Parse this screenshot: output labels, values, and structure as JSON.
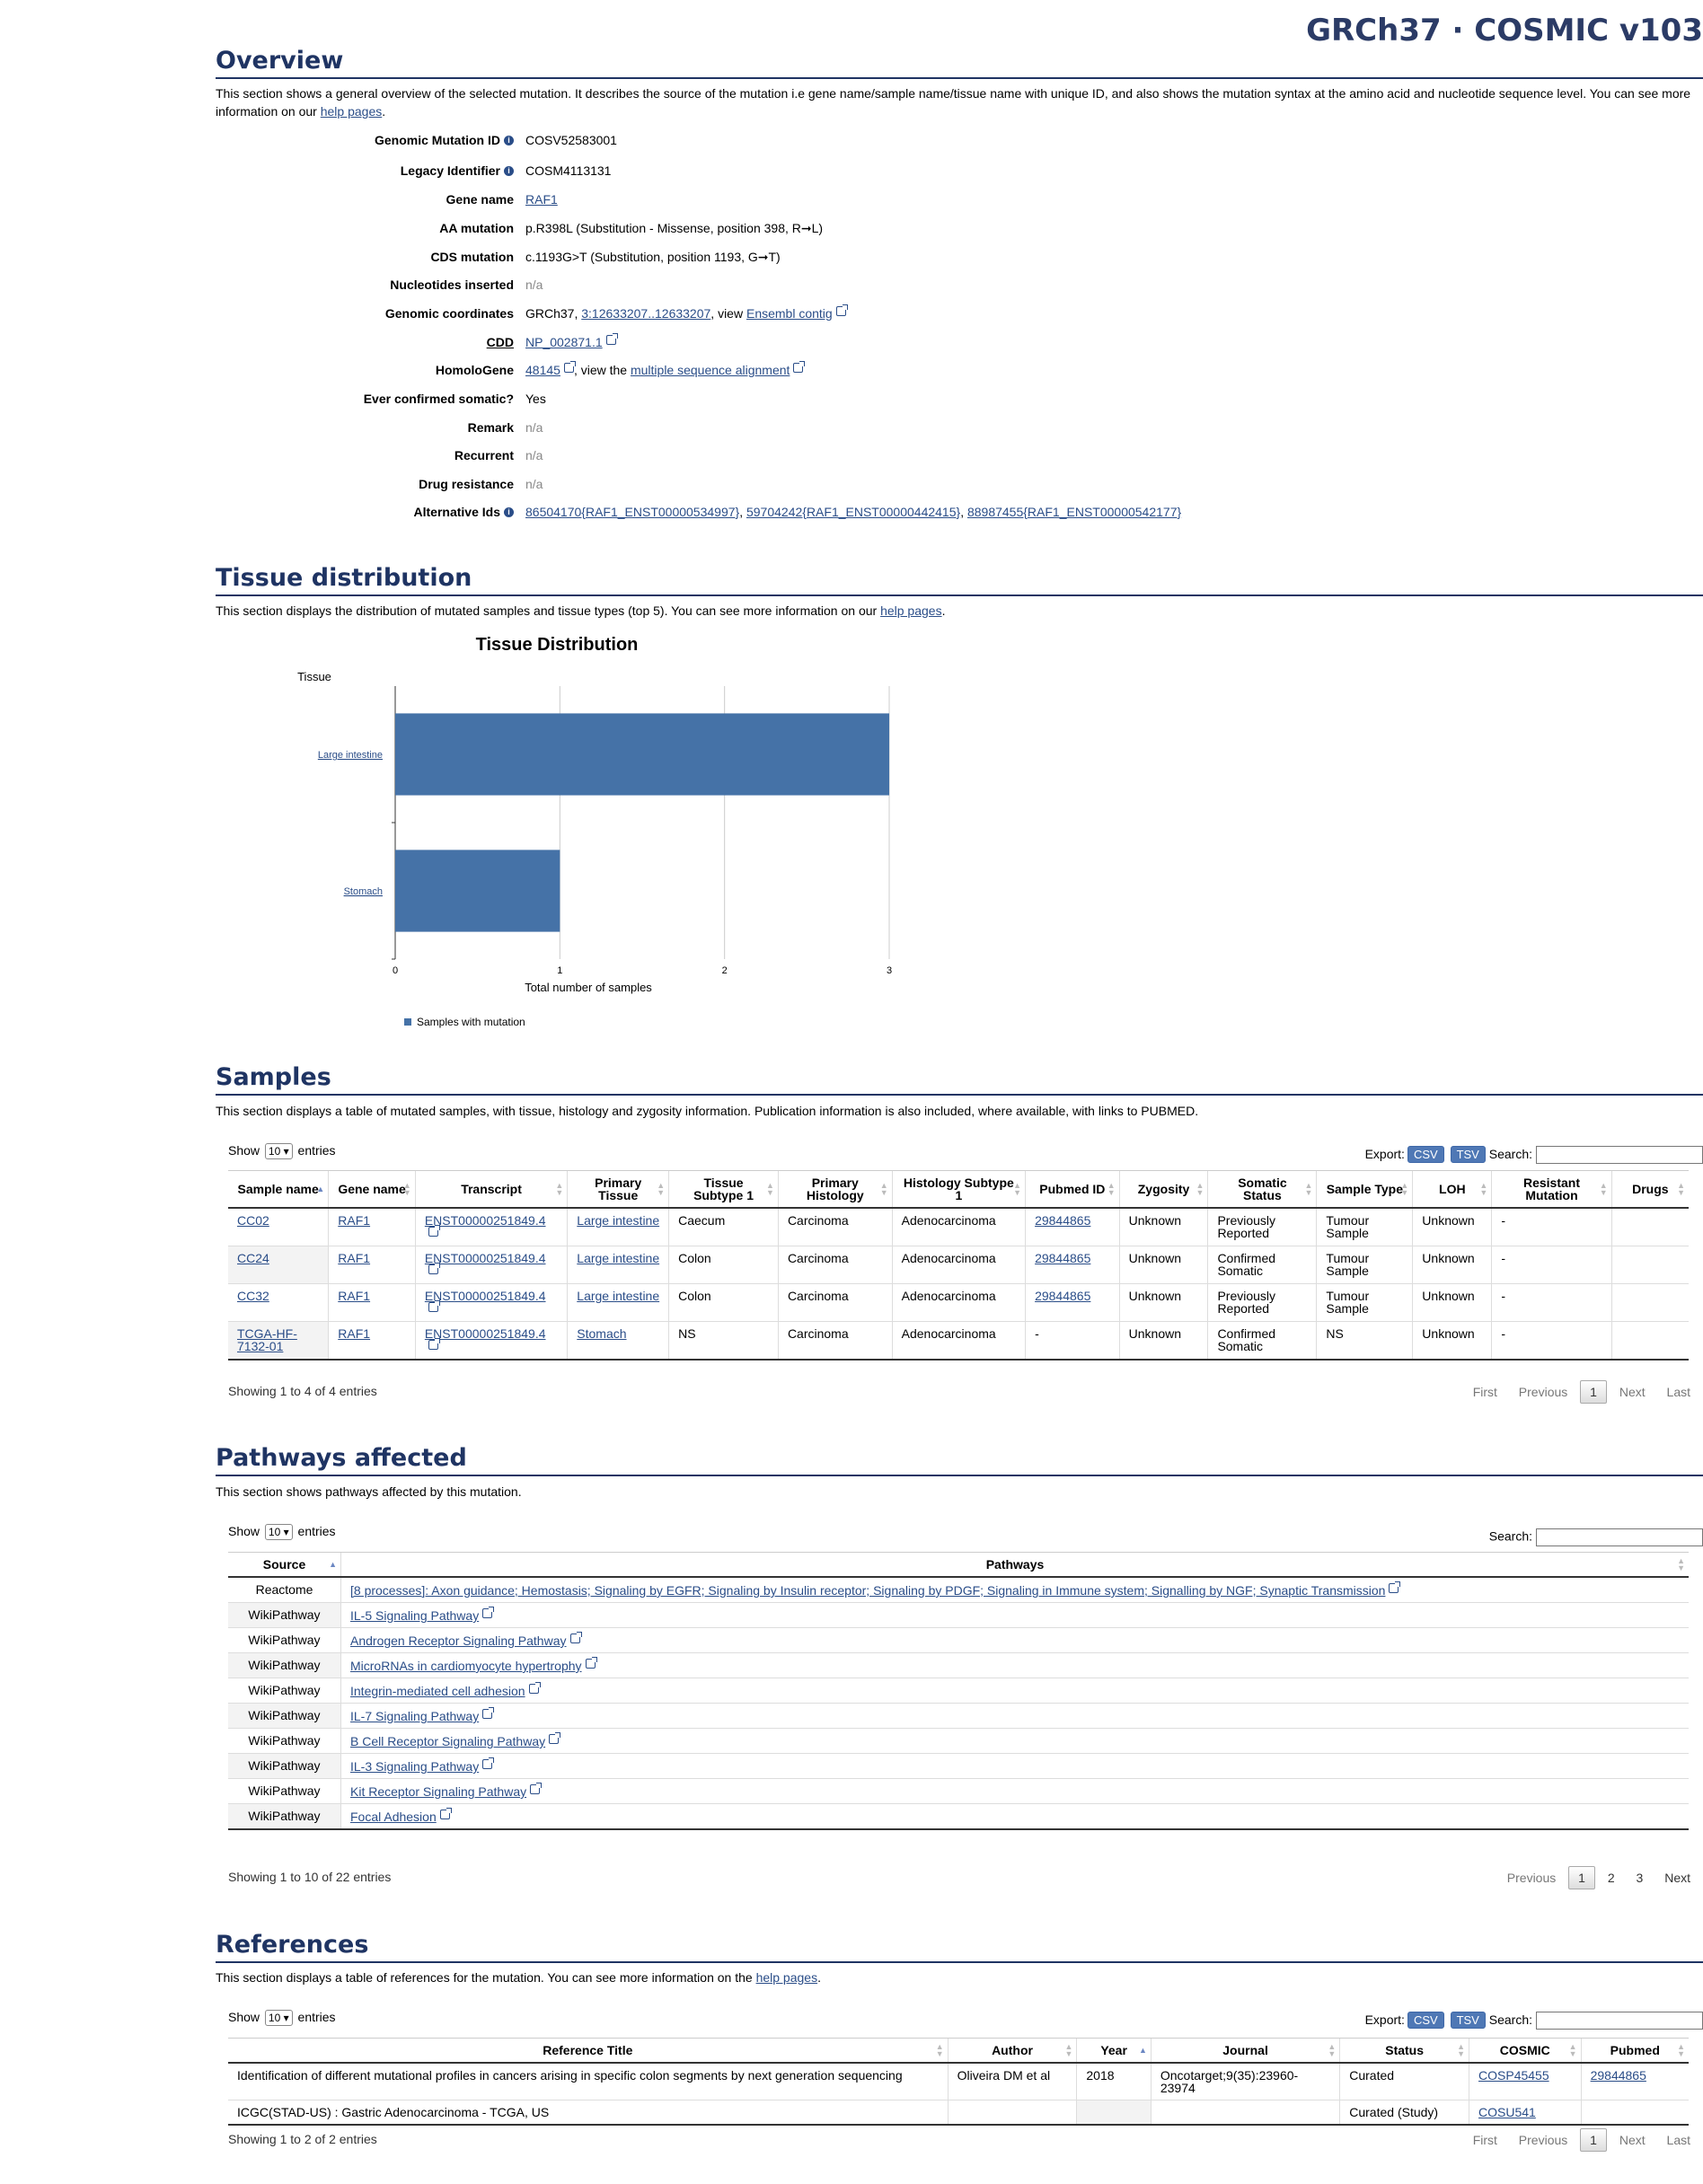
{
  "header": {
    "brand": "GRCh37 · COSMIC v103"
  },
  "overview": {
    "title": "Overview",
    "desc_pre": "This section shows a general overview of the selected mutation. It describes the source of the mutation i.e gene name/sample name/tissue name with unique ID, and also shows the mutation syntax at the amino acid and nucleotide sequence level. You can see more information on our ",
    "desc_link": "help pages",
    "desc_post": ".",
    "fields": {
      "genomic_mutation_id": {
        "label": "Genomic Mutation ID",
        "value": "COSV52583001"
      },
      "legacy_identifier": {
        "label": "Legacy Identifier",
        "value": "COSM4113131"
      },
      "gene_name": {
        "label": "Gene name",
        "value": "RAF1"
      },
      "aa_mutation": {
        "label": "AA mutation",
        "value": "p.R398L (Substitution - Missense, position 398, R➞L)"
      },
      "cds_mutation": {
        "label": "CDS mutation",
        "value": "c.1193G>T (Substitution, position 1193, G➞T)"
      },
      "nucleotides_inserted": {
        "label": "Nucleotides inserted",
        "value": "n/a"
      },
      "genomic_coordinates": {
        "label": "Genomic coordinates",
        "prefix": "GRCh37, ",
        "coord_link": "3:12633207..12633207",
        "mid": ", view ",
        "ensembl_link": "Ensembl contig"
      },
      "cdd": {
        "label": "CDD",
        "value": "NP_002871.1"
      },
      "homologene": {
        "label": "HomoloGene",
        "value": "48145",
        "mid": ", view the ",
        "msa_link": "multiple sequence alignment"
      },
      "ever_confirmed_somatic": {
        "label": "Ever confirmed somatic?",
        "value": "Yes"
      },
      "remark": {
        "label": "Remark",
        "value": "n/a"
      },
      "recurrent": {
        "label": "Recurrent",
        "value": "n/a"
      },
      "drug_resistance": {
        "label": "Drug resistance",
        "value": "n/a"
      },
      "alternative_ids": {
        "label": "Alternative Ids",
        "ids": [
          "86504170{RAF1_ENST00000534997}",
          "59704242{RAF1_ENST00000442415}",
          "88987455{RAF1_ENST00000542177}"
        ],
        "sep": ", "
      }
    }
  },
  "tissue": {
    "title": "Tissue distribution",
    "desc_pre": "This section displays the distribution of mutated samples and tissue types (top 5). You can see more information on our ",
    "desc_link": "help pages",
    "desc_post": "."
  },
  "chart_data": {
    "type": "bar",
    "orientation": "horizontal",
    "title": "Tissue Distribution",
    "ylabel": "Tissue",
    "xlabel": "Total number of samples",
    "categories": [
      "Large intestine",
      "Stomach"
    ],
    "series": [
      {
        "name": "Samples with mutation",
        "values": [
          3,
          1
        ],
        "color": "#4572a7"
      }
    ],
    "xlim": [
      0,
      3
    ],
    "xticks": [
      "0",
      "1",
      "2",
      "3"
    ],
    "grid": true,
    "legend": "bottom-left"
  },
  "samples": {
    "title": "Samples",
    "desc": "This section displays a table of mutated samples, with tissue, histology and zygosity information. Publication information is also included, where available, with links to PUBMED.",
    "show": "Show",
    "entries_count": "10",
    "entries": "entries",
    "export": "Export:",
    "csv": "CSV",
    "tsv": "TSV",
    "search": "Search:",
    "columns": [
      "Sample name",
      "Gene name",
      "Transcript",
      "Primary Tissue",
      "Tissue Subtype 1",
      "Primary Histology",
      "Histology Subtype 1",
      "Pubmed ID",
      "Zygosity",
      "Somatic Status",
      "Sample Type",
      "LOH",
      "Resistant Mutation",
      "Drugs"
    ],
    "rows": [
      [
        "CC02",
        "RAF1",
        "ENST00000251849.4",
        "Large intestine",
        "Caecum",
        "Carcinoma",
        "Adenocarcinoma",
        "29844865",
        "Unknown",
        "Previously Reported",
        "Tumour Sample",
        "Unknown",
        "-",
        ""
      ],
      [
        "CC24",
        "RAF1",
        "ENST00000251849.4",
        "Large intestine",
        "Colon",
        "Carcinoma",
        "Adenocarcinoma",
        "29844865",
        "Unknown",
        "Confirmed Somatic",
        "Tumour Sample",
        "Unknown",
        "-",
        ""
      ],
      [
        "CC32",
        "RAF1",
        "ENST00000251849.4",
        "Large intestine",
        "Colon",
        "Carcinoma",
        "Adenocarcinoma",
        "29844865",
        "Unknown",
        "Previously Reported",
        "Tumour Sample",
        "Unknown",
        "-",
        ""
      ],
      [
        "TCGA-HF-7132-01",
        "RAF1",
        "ENST00000251849.4",
        "Stomach",
        "NS",
        "Carcinoma",
        "Adenocarcinoma",
        "-",
        "Unknown",
        "Confirmed Somatic",
        "NS",
        "Unknown",
        "-",
        ""
      ]
    ],
    "info": "Showing 1 to 4 of 4 entries",
    "pager": {
      "first": "First",
      "previous": "Previous",
      "page": "1",
      "next": "Next",
      "last": "Last"
    }
  },
  "pathways": {
    "title": "Pathways affected",
    "desc": "This section shows pathways affected by this mutation.",
    "show": "Show",
    "entries_count": "10",
    "entries": "entries",
    "search": "Search:",
    "columns": [
      "Source",
      "Pathways"
    ],
    "rows": [
      [
        "Reactome",
        "[8 processes]: Axon guidance; Hemostasis; Signaling by EGFR; Signaling by Insulin receptor; Signaling by PDGF; Signaling in Immune system; Signalling by NGF; Synaptic Transmission"
      ],
      [
        "WikiPathway",
        "IL-5 Signaling Pathway"
      ],
      [
        "WikiPathway",
        "Androgen Receptor Signaling Pathway"
      ],
      [
        "WikiPathway",
        "MicroRNAs in cardiomyocyte hypertrophy"
      ],
      [
        "WikiPathway",
        "Integrin-mediated cell adhesion"
      ],
      [
        "WikiPathway",
        "IL-7 Signaling Pathway"
      ],
      [
        "WikiPathway",
        "B Cell Receptor Signaling Pathway"
      ],
      [
        "WikiPathway",
        "IL-3 Signaling Pathway"
      ],
      [
        "WikiPathway",
        "Kit Receptor Signaling Pathway"
      ],
      [
        "WikiPathway",
        "Focal Adhesion"
      ]
    ],
    "info": "Showing 1 to 10 of 22 entries",
    "pager": {
      "previous": "Previous",
      "pages": [
        "1",
        "2",
        "3"
      ],
      "next": "Next"
    }
  },
  "references": {
    "title": "References",
    "desc_pre": "This section displays a table of references for the mutation. You can see more information on the ",
    "desc_link": "help pages",
    "desc_post": ".",
    "show": "Show",
    "entries_count": "10",
    "entries": "entries",
    "export": "Export:",
    "csv": "CSV",
    "tsv": "TSV",
    "search": "Search:",
    "columns": [
      "Reference Title",
      "Author",
      "Year",
      "Journal",
      "Status",
      "COSMIC",
      "Pubmed"
    ],
    "rows": [
      [
        "Identification of different mutational profiles in cancers arising in specific colon segments by next generation sequencing",
        "Oliveira DM et al",
        "2018",
        "Oncotarget;9(35):23960-23974",
        "Curated",
        "COSP45455",
        "29844865"
      ],
      [
        "ICGC(STAD-US) : Gastric Adenocarcinoma - TCGA, US",
        "",
        "",
        "",
        "Curated (Study)",
        "COSU541",
        ""
      ]
    ],
    "info": "Showing 1 to 2 of 2 entries",
    "pager": {
      "first": "First",
      "previous": "Previous",
      "page": "1",
      "next": "Next",
      "last": "Last"
    }
  }
}
